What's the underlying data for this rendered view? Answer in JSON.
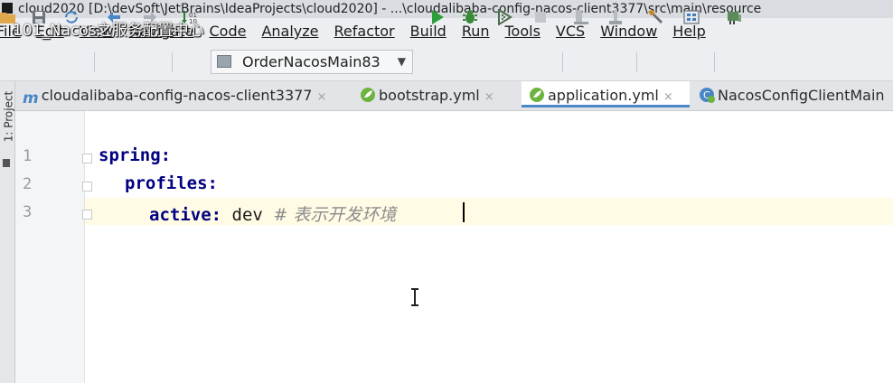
{
  "window": {
    "title": "cloud2020 [D:\\devSoft\\JetBrains\\IdeaProjects\\cloud2020] - ...\\cloudalibaba-config-nacos-client3377\\src\\main\\resource",
    "overlay_caption": "101_Nacos之服务配置中心"
  },
  "menu": {
    "items": [
      "File",
      "Edit",
      "View",
      "Navigate",
      "Code",
      "Analyze",
      "Refactor",
      "Build",
      "Run",
      "Tools",
      "VCS",
      "Window",
      "Help"
    ]
  },
  "toolbar": {
    "run_configuration": "OrderNacosMain83",
    "icons": [
      "open-folder-icon",
      "save-icon",
      "sync-icon",
      "back-icon",
      "forward-icon",
      "build-icon",
      "run-icon",
      "debug-icon",
      "coverage-icon",
      "stop-icon",
      "attach-icon",
      "profiler-icon",
      "settings-icon",
      "project-structure-icon",
      "sdk-download-icon"
    ],
    "colors": {
      "run": "#2e9e3a",
      "debug": "#3a8a3a"
    }
  },
  "sidebar": {
    "project_label": "1: Project"
  },
  "tabs": [
    {
      "label": "cloudalibaba-config-nacos-client3377",
      "close": "×",
      "icon": "module-icon",
      "active": false
    },
    {
      "label": "bootstrap.yml",
      "close": "×",
      "icon": "spring-leaf-icon",
      "active": false
    },
    {
      "label": "application.yml",
      "close": "×",
      "icon": "spring-leaf-icon",
      "active": true
    },
    {
      "label": "NacosConfigClientMain",
      "close": "",
      "icon": "spring-class-icon",
      "active": false
    }
  ],
  "editor": {
    "lines": [
      {
        "number": "1",
        "key": "spring:",
        "value": "",
        "comment": ""
      },
      {
        "number": "2",
        "key": "profiles:",
        "value": "",
        "comment": ""
      },
      {
        "number": "3",
        "key": "active:",
        "value": "dev",
        "comment": "# 表示开发环境"
      }
    ],
    "colors": {
      "key": "#000080",
      "comment": "#8c8c8c",
      "current_line": "#fffbe4"
    }
  }
}
